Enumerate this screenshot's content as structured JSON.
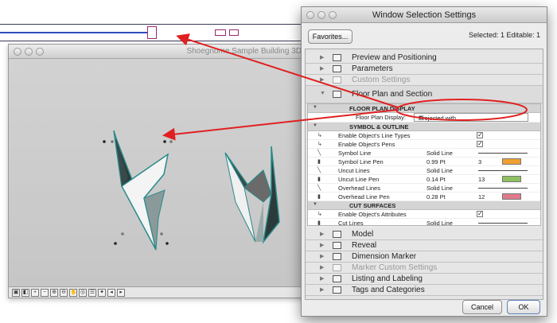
{
  "window3d": {
    "title": "Shoegnome Sample Building 3D"
  },
  "dialog": {
    "title": "Window Selection Settings",
    "favorites_button": "Favorites...",
    "selection_info": "Selected: 1 Editable: 1",
    "cancel_button": "Cancel",
    "ok_button": "OK",
    "sections_top": [
      {
        "label": "Preview and Positioning",
        "icon": "preview-icon",
        "dim": false
      },
      {
        "label": "Parameters",
        "icon": "parameters-icon",
        "dim": false
      },
      {
        "label": "Custom Settings",
        "icon": "custom-settings-icon",
        "dim": true
      },
      {
        "label": "Floor Plan and Section",
        "icon": "floor-plan-icon",
        "dim": false
      }
    ],
    "floor_plan": {
      "group_display": "FLOOR PLAN DISPLAY",
      "floor_plan_display_label": "Floor Plan Display:",
      "floor_plan_display_value": "Projected with...",
      "group_symbol": "SYMBOL & OUTLINE",
      "rows": [
        {
          "name": "Enable Object's Line Types",
          "value": "",
          "type": "check",
          "checked": "✓"
        },
        {
          "name": "Enable Object's Pens",
          "value": "",
          "type": "check",
          "checked": "✓"
        },
        {
          "name": "Symbol Line",
          "value": "Solid Line",
          "type": "line"
        },
        {
          "name": "Symbol Line Pen",
          "value": "0.99 Pt",
          "type": "pen",
          "pen_number": "3",
          "pen_color": "#f0a030"
        },
        {
          "name": "Uncut Lines",
          "value": "Solid Line",
          "type": "line"
        },
        {
          "name": "Uncut Line Pen",
          "value": "0.14 Pt",
          "type": "pen",
          "pen_number": "13",
          "pen_color": "#8fc060"
        },
        {
          "name": "Overhead Lines",
          "value": "Solid Line",
          "type": "line"
        },
        {
          "name": "Overhead Line Pen",
          "value": "0.28 Pt",
          "type": "pen",
          "pen_number": "12",
          "pen_color": "#e07a8a"
        }
      ],
      "group_cut": "CUT SURFACES",
      "cut_rows": [
        {
          "name": "Enable Object's Attributes",
          "value": "",
          "type": "check",
          "checked": "✓"
        },
        {
          "name": "Cut Lines",
          "value": "Solid Line",
          "type": "line"
        }
      ]
    },
    "sections_bottom": [
      {
        "label": "Model",
        "icon": "model-icon",
        "dim": false
      },
      {
        "label": "Reveal",
        "icon": "reveal-icon",
        "dim": false
      },
      {
        "label": "Dimension Marker",
        "icon": "dimension-marker-icon",
        "dim": false
      },
      {
        "label": "Marker Custom Settings",
        "icon": "marker-custom-icon",
        "dim": true
      },
      {
        "label": "Listing and Labeling",
        "icon": "listing-icon",
        "dim": false
      },
      {
        "label": "Tags and Categories",
        "icon": "tags-icon",
        "dim": false
      }
    ]
  },
  "colors": {
    "annotation": "#e02020",
    "teal_edge": "#2a8a8a"
  }
}
